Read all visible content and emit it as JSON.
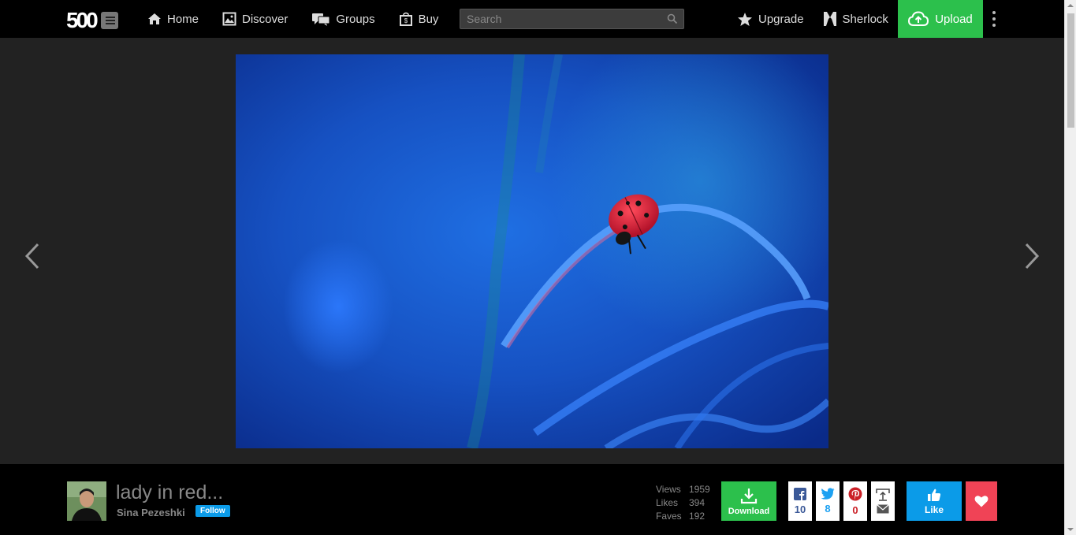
{
  "header": {
    "logo_text": "500",
    "nav": [
      {
        "label": "Home",
        "icon": "home-icon"
      },
      {
        "label": "Discover",
        "icon": "image-icon"
      },
      {
        "label": "Groups",
        "icon": "chat-icon"
      },
      {
        "label": "Buy",
        "icon": "shopping-bag-icon"
      }
    ],
    "search_placeholder": "Search",
    "upgrade_label": "Upgrade",
    "user_label": "Sherlock",
    "upload_label": "Upload"
  },
  "photo": {
    "title": "lady in red...",
    "author": "Sina Pezeshki",
    "follow_label": "Follow"
  },
  "stats": {
    "views_label": "Views",
    "views": "1959",
    "likes_label": "Likes",
    "likes": "394",
    "faves_label": "Faves",
    "faves": "192"
  },
  "actions": {
    "download_label": "Download",
    "facebook_count": "10",
    "twitter_count": "8",
    "pinterest_count": "0",
    "like_label": "Like"
  },
  "colors": {
    "upload_green": "#2cc04c",
    "like_blue": "#0b9be8",
    "fave_red": "#f04356"
  }
}
